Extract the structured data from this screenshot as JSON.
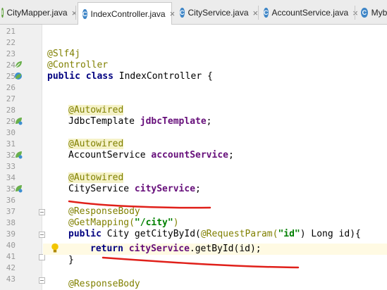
{
  "tabs": [
    {
      "label": "CityMapper.java",
      "icon": "interface-icon",
      "glyph": "I",
      "active": false
    },
    {
      "label": "IndexController.java",
      "icon": "class-icon",
      "glyph": "C",
      "active": true
    },
    {
      "label": "CityService.java",
      "icon": "class-icon",
      "glyph": "C",
      "active": false
    },
    {
      "label": "AccountService.java",
      "icon": "class-icon",
      "glyph": "C",
      "active": false
    },
    {
      "label": "Myba",
      "icon": "class-icon",
      "glyph": "C",
      "active": false
    }
  ],
  "tab_close_glyph": "×",
  "line_numbers": [
    "21",
    "22",
    "23",
    "24",
    "25",
    "26",
    "27",
    "28",
    "29",
    "30",
    "31",
    "32",
    "33",
    "34",
    "35",
    "36",
    "37",
    "38",
    "39",
    "40",
    "41",
    "42",
    "43"
  ],
  "code": {
    "l23": "@Slf4j",
    "l24": "@Controller",
    "l25_kw1": "public",
    "l25_kw2": "class",
    "l25_rest": " IndexController {",
    "autowired": "@Autowired",
    "l29_type": "JdbcTemplate ",
    "l29_field": "jdbcTemplate",
    "semicolon": ";",
    "l32_type": "AccountService ",
    "l32_field": "accountService",
    "l35_type": "CityService ",
    "l35_field": "cityService",
    "l38": "@ResponseBody",
    "l39_anno": "@GetMapping(",
    "l39_str": "\"/city\"",
    "l39_close": ")",
    "l40_kw": "public",
    "l40_a": " City getCityById(",
    "l40_anno": "@RequestParam(",
    "l40_str": "\"id\"",
    "l40_b": ") Long id){",
    "l41_kw": "return",
    "l41_field": "cityService",
    "l41_rest": ".getById(id);",
    "l42": "}",
    "l44": "@ResponseBody"
  },
  "colors": {
    "annotation": "#808000",
    "keyword": "#000080",
    "field": "#660e7a",
    "string": "#008000",
    "underline": "#e0201a",
    "current_line": "#fffae3"
  }
}
